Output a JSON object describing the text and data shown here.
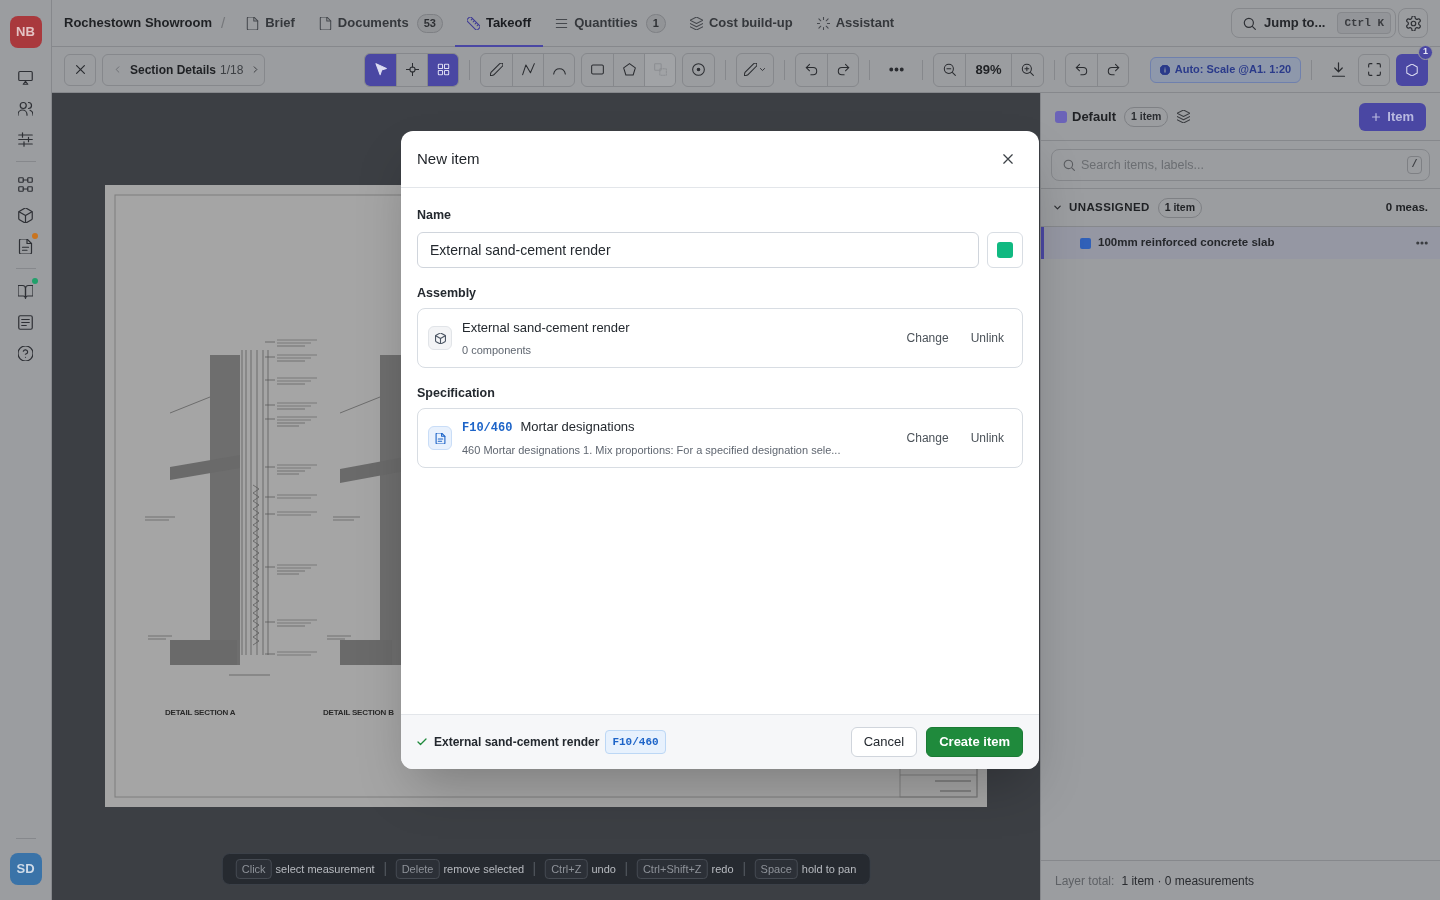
{
  "rail": {
    "workspace_initials": "NB",
    "groups": [
      [
        {
          "dot": false
        },
        {
          "dot": false
        },
        {
          "dot": false
        }
      ],
      [
        {
          "dot": false
        },
        {
          "dot": false
        },
        {
          "dot": true,
          "color": "#c9741f"
        }
      ],
      [
        {
          "dot": true,
          "color": "#22a06b"
        },
        {
          "dot": false
        },
        {
          "dot": false
        }
      ]
    ],
    "user_initials": "SD"
  },
  "top_bar": {
    "project": "Rochestown Showroom",
    "separator": "/",
    "tabs": [
      {
        "label": "Brief",
        "selected": false
      },
      {
        "label": "Documents",
        "count": "53",
        "selected": false
      },
      {
        "label": "Takeoff",
        "selected": true
      },
      {
        "label": "Quantities",
        "count": "1",
        "selected": false
      },
      {
        "label": "Cost build-up",
        "selected": false
      },
      {
        "label": "Assistant",
        "selected": false
      }
    ],
    "jump": {
      "label": "Jump to...",
      "shortcut": "Ctrl K"
    }
  },
  "toolbar": {
    "sheet": {
      "name": "Section Details",
      "page": "1/18"
    },
    "tool_groups": [
      {
        "items": [
          {
            "selected": true,
            "disabled": false
          },
          {
            "selected": false,
            "disabled": false
          },
          {
            "selected": true,
            "disabled": false
          }
        ]
      },
      {
        "items": [
          {
            "selected": false,
            "disabled": false
          },
          {
            "selected": false,
            "disabled": false
          },
          {
            "selected": false,
            "disabled": false
          }
        ]
      },
      {
        "items": [
          {
            "selected": false,
            "disabled": false
          },
          {
            "selected": false,
            "disabled": false
          },
          {
            "selected": false,
            "disabled": true
          }
        ]
      },
      {
        "items": [
          {
            "selected": false,
            "disabled": false
          }
        ]
      },
      {
        "items": [
          {
            "selected": false,
            "disabled": false
          }
        ]
      }
    ],
    "zoom": "89%",
    "scale": "Auto: Scale @A1. 1:20",
    "notifications": "1"
  },
  "canvas": {
    "sheet_labels": [
      "DETAIL SECTION A",
      "DETAIL SECTION B"
    ],
    "shortcuts": [
      {
        "key": "Click",
        "action": "select measurement"
      },
      {
        "key": "Delete",
        "action": "remove selected"
      },
      {
        "key": "Ctrl+Z",
        "action": "undo"
      },
      {
        "key": "Ctrl+Shift+Z",
        "action": "redo"
      },
      {
        "key": "Space",
        "action": "hold to pan"
      }
    ]
  },
  "right_panel": {
    "layer": {
      "name": "Default",
      "count": "1 item"
    },
    "add_button": "Item",
    "search": {
      "placeholder": "Search items, labels...",
      "shortcut": "/"
    },
    "group": {
      "label": "UNASSIGNED",
      "count": "1 item",
      "measurements": "0 meas.",
      "expanded": true,
      "items": [
        {
          "name": "100mm reinforced concrete slab",
          "color": "#3060b8",
          "selected": true
        }
      ]
    },
    "footer": {
      "label": "Layer total:",
      "value": "1 item · 0 measurements"
    }
  },
  "modal": {
    "title": "New item",
    "name_field": {
      "label": "Name",
      "value": "External sand-cement render",
      "color": "#10b981"
    },
    "assembly": {
      "label": "Assembly",
      "title": "External sand-cement render",
      "subtitle": "0 components",
      "actions": [
        "Change",
        "Unlink"
      ]
    },
    "specification": {
      "label": "Specification",
      "code": "F10/460",
      "title": "Mortar designations",
      "subtitle": "460 Mortar designations 1. Mix proportions: For a specified designation sele...",
      "actions": [
        "Change",
        "Unlink"
      ]
    },
    "summary": {
      "valid": true,
      "name": "External sand-cement render",
      "code": "F10/460"
    },
    "buttons": [
      {
        "label": "Cancel",
        "kind": "secondary"
      },
      {
        "label": "Create item",
        "kind": "primary"
      }
    ]
  }
}
